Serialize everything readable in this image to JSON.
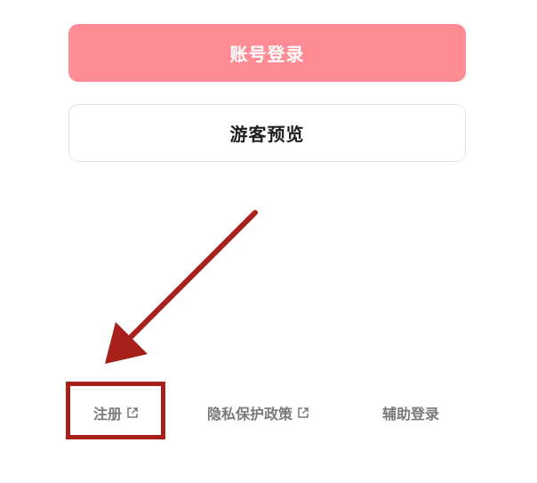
{
  "buttons": {
    "account_login": "账号登录",
    "guest_preview": "游客预览"
  },
  "footer": {
    "register": "注册",
    "privacy_policy": "隐私保护政策",
    "assisted_login": "辅助登录"
  },
  "icons": {
    "register_link_icon": "external-link-icon",
    "privacy_link_icon": "external-link-icon"
  },
  "colors": {
    "primary_button": "#ff8c95",
    "annotation": "#a8201a"
  }
}
